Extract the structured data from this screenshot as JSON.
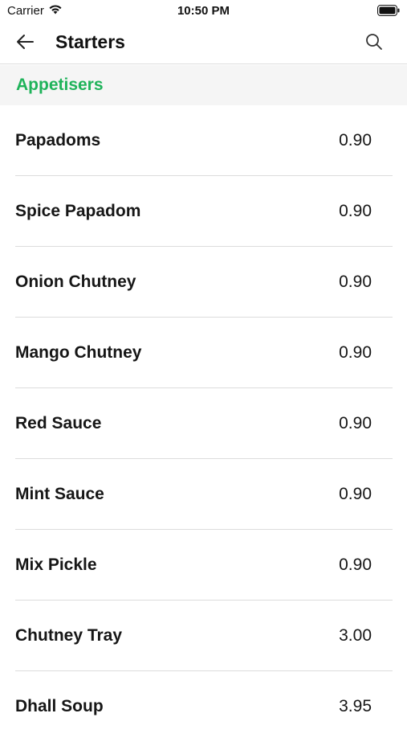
{
  "status_bar": {
    "carrier": "Carrier",
    "time": "10:50 PM"
  },
  "nav": {
    "title": "Starters",
    "back_icon": "arrow-left-icon",
    "search_icon": "search-icon"
  },
  "section": {
    "title": "Appetisers",
    "color": "#1fb35a"
  },
  "items": [
    {
      "name": "Papadoms",
      "price": "0.90"
    },
    {
      "name": "Spice Papadom",
      "price": "0.90"
    },
    {
      "name": "Onion Chutney",
      "price": "0.90"
    },
    {
      "name": "Mango Chutney",
      "price": "0.90"
    },
    {
      "name": "Red Sauce",
      "price": "0.90"
    },
    {
      "name": "Mint Sauce",
      "price": "0.90"
    },
    {
      "name": "Mix Pickle",
      "price": "0.90"
    },
    {
      "name": "Chutney Tray",
      "price": "3.00"
    },
    {
      "name": "Dhall Soup",
      "price": "3.95"
    }
  ]
}
